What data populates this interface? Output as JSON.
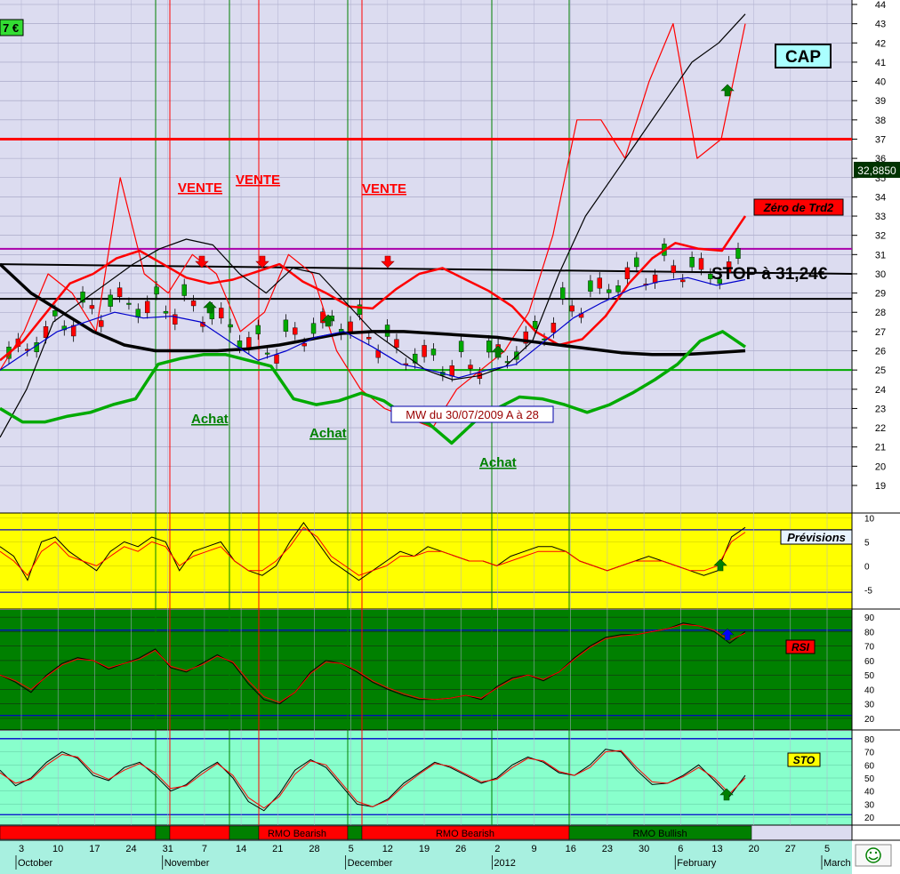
{
  "chart_data": [
    {
      "type": "line",
      "panel": "price",
      "ylim": [
        18,
        44
      ],
      "y_ticks": [
        19,
        20,
        21,
        22,
        23,
        24,
        25,
        26,
        27,
        28,
        29,
        30,
        31,
        32,
        33,
        34,
        35,
        36,
        37,
        38,
        39,
        40,
        41,
        42,
        43,
        44
      ],
      "x_ticks": [
        "3",
        "10",
        "17",
        "24",
        "31",
        "7",
        "14",
        "21",
        "28",
        "5",
        "12",
        "19",
        "26",
        "2",
        "9",
        "16",
        "23",
        "30",
        "6",
        "13",
        "20",
        "27",
        "5"
      ],
      "month_labels": [
        "October",
        "November",
        "December",
        "2012",
        "February",
        "March"
      ],
      "title_badge": "CAP",
      "corner_badge": "7 €",
      "last_price": "32,8850",
      "zero_label": "Zéro de Trd2",
      "stop_label": "STOP à 31,24€",
      "signal_note": "MW du 30/07/2009   A à 28",
      "sell_labels": [
        "VENTE",
        "VENTE",
        "VENTE"
      ],
      "buy_labels": [
        "Achat",
        "Achat",
        "Achat"
      ],
      "levels": [
        {
          "value": 37,
          "color": "#ff0000"
        },
        {
          "value": 31.3,
          "color": "#aa00aa"
        },
        {
          "value": 28.7,
          "color": "#000000"
        },
        {
          "value": 25,
          "color": "#00aa00"
        }
      ],
      "series": [
        {
          "color": "#ff0000",
          "width": 2.5,
          "y": [
            25.5,
            26.5,
            28,
            29.5,
            30,
            30.8,
            31.2,
            30.5,
            29.8,
            29.5,
            29.7,
            30.1,
            30.5,
            29.6,
            29,
            28.3,
            28.2,
            29.2,
            30,
            30.3,
            29.7,
            29.1,
            28.3,
            27,
            26.3,
            26.6,
            27.8,
            29.5,
            30.8,
            31.6,
            31.3,
            31.2,
            33
          ]
        },
        {
          "color": "#ff0000",
          "width": 1.2,
          "y": [
            25,
            27,
            30,
            29,
            27,
            35,
            30,
            29,
            31,
            30,
            27,
            28,
            31,
            30,
            26,
            24,
            23,
            22.5,
            22,
            24,
            25,
            26,
            28,
            32,
            38,
            38,
            36,
            40,
            43,
            36,
            37,
            43
          ]
        },
        {
          "color": "#000000",
          "width": 3.5,
          "y": [
            30.5,
            29,
            28,
            27,
            26.3,
            26,
            26,
            26,
            26.1,
            26.3,
            26.6,
            26.9,
            27,
            27,
            26.9,
            26.8,
            26.7,
            26.5,
            26.3,
            26.1,
            25.9,
            25.8,
            25.8,
            25.9,
            26
          ]
        },
        {
          "color": "#000000",
          "width": 1.2,
          "y": [
            21.5,
            24,
            27.5,
            28.5,
            29.5,
            30.5,
            31.3,
            31.8,
            31.5,
            30,
            29,
            30.3,
            30,
            28.5,
            27,
            26,
            25,
            24.5,
            24.7,
            25.2,
            26.5,
            30,
            33,
            35,
            37,
            39,
            41,
            42,
            43.5
          ]
        },
        {
          "color": "#0000cc",
          "width": 1.2,
          "y": [
            25,
            26,
            27,
            27.5,
            28,
            27.7,
            27.8,
            27.5,
            26.5,
            25.5,
            26,
            26.7,
            27,
            26.2,
            25.3,
            25,
            24.6,
            25,
            25.3,
            26.5,
            27.7,
            28.5,
            29.2,
            29.6,
            29.8,
            29.4,
            29.7
          ]
        },
        {
          "color": "#00aa00",
          "width": 3.5,
          "y": [
            23,
            22.3,
            22.3,
            22.6,
            22.8,
            23.2,
            23.5,
            25.3,
            25.6,
            25.8,
            25.8,
            25.5,
            25.2,
            23.5,
            23.2,
            23.4,
            23.8,
            23.4,
            22.6,
            22.2,
            21.2,
            22.3,
            23,
            23.6,
            23.5,
            23.2,
            22.8,
            23.2,
            23.8,
            24.5,
            25.3,
            26.5,
            27,
            26.2
          ]
        }
      ]
    },
    {
      "type": "line",
      "panel": "oscillator",
      "label": "Prévisions",
      "ylim": [
        -9,
        11
      ],
      "y_ticks": [
        -5,
        0,
        5,
        10
      ],
      "levels": [
        7.5,
        -5.5
      ],
      "series": [
        {
          "color": "#000000",
          "y": [
            4,
            2,
            -3,
            5,
            6,
            3,
            1,
            -1,
            3,
            5,
            4,
            6,
            5,
            -1,
            3,
            4,
            5,
            1,
            -1,
            -2,
            0,
            5,
            9,
            5,
            1,
            -1,
            -3,
            -1,
            1,
            3,
            2,
            4,
            3,
            2,
            1,
            1,
            0,
            2,
            3,
            4,
            4,
            3,
            1,
            0,
            -1,
            0,
            1,
            2,
            1,
            0,
            -1,
            -2,
            -1,
            6,
            8
          ]
        },
        {
          "color": "#ff0000",
          "y": [
            3,
            1,
            -2,
            3,
            5,
            2,
            1,
            0,
            2,
            4,
            3,
            5,
            4,
            0,
            2,
            3,
            4,
            1,
            -1,
            -1,
            1,
            4,
            8,
            6,
            2,
            0,
            -2,
            -1,
            0,
            2,
            2,
            3,
            3,
            2,
            1,
            1,
            0,
            1,
            2,
            3,
            3,
            3,
            1,
            0,
            -1,
            0,
            1,
            1,
            1,
            0,
            -1,
            -1,
            0,
            5,
            7
          ]
        }
      ]
    },
    {
      "type": "line",
      "panel": "oscillator",
      "label": "RSI",
      "ylim": [
        12,
        95
      ],
      "y_ticks": [
        20,
        30,
        40,
        50,
        60,
        70,
        80,
        90
      ],
      "levels": [
        81,
        22
      ],
      "series": [
        {
          "color": "#000000",
          "y": [
            50,
            45,
            38,
            50,
            58,
            62,
            60,
            54,
            58,
            62,
            68,
            55,
            52,
            58,
            64,
            58,
            44,
            33,
            30,
            38,
            52,
            60,
            58,
            52,
            45,
            40,
            36,
            33,
            33,
            34,
            36,
            33,
            42,
            48,
            50,
            46,
            52,
            62,
            70,
            76,
            78,
            78,
            80,
            82,
            86,
            84,
            80,
            72,
            80
          ]
        },
        {
          "color": "#ff0000",
          "y": [
            50,
            46,
            40,
            49,
            57,
            61,
            60,
            55,
            58,
            61,
            67,
            56,
            53,
            57,
            63,
            59,
            46,
            35,
            31,
            38,
            51,
            59,
            58,
            53,
            46,
            41,
            37,
            34,
            33,
            34,
            36,
            34,
            41,
            47,
            50,
            47,
            52,
            61,
            69,
            75,
            77,
            78,
            80,
            82,
            85,
            84,
            81,
            74,
            79
          ]
        }
      ]
    },
    {
      "type": "line",
      "panel": "oscillator",
      "label": "STO",
      "ylim": [
        14,
        86
      ],
      "y_ticks": [
        20,
        30,
        40,
        50,
        60,
        70,
        80
      ],
      "levels": [
        80,
        22
      ],
      "series": [
        {
          "color": "#000000",
          "y": [
            56,
            44,
            50,
            62,
            70,
            65,
            52,
            48,
            58,
            62,
            52,
            40,
            45,
            55,
            62,
            50,
            32,
            25,
            38,
            56,
            64,
            58,
            44,
            30,
            28,
            34,
            46,
            54,
            62,
            58,
            52,
            46,
            50,
            60,
            66,
            62,
            54,
            52,
            60,
            72,
            70,
            56,
            45,
            46,
            52,
            60,
            48,
            36,
            52
          ]
        },
        {
          "color": "#ff0000",
          "y": [
            54,
            46,
            49,
            60,
            68,
            66,
            54,
            49,
            56,
            61,
            54,
            42,
            44,
            53,
            61,
            52,
            35,
            27,
            36,
            53,
            63,
            60,
            46,
            32,
            28,
            33,
            44,
            53,
            61,
            59,
            53,
            47,
            49,
            58,
            65,
            63,
            55,
            52,
            58,
            70,
            71,
            58,
            47,
            46,
            51,
            58,
            50,
            38,
            50
          ]
        }
      ]
    }
  ],
  "rmo_labels": [
    "RMO Bearish",
    "RMO Bearish",
    "RMO Bullish"
  ],
  "palette": {
    "price_bg": "#dcdcf0",
    "prev_bg": "#ffff00",
    "rsi_bg": "#008000",
    "sto_bg": "#88ffcc",
    "rmo_red": "#ff0000",
    "rmo_green": "#008000"
  },
  "smiley_icon": "smiley-icon"
}
